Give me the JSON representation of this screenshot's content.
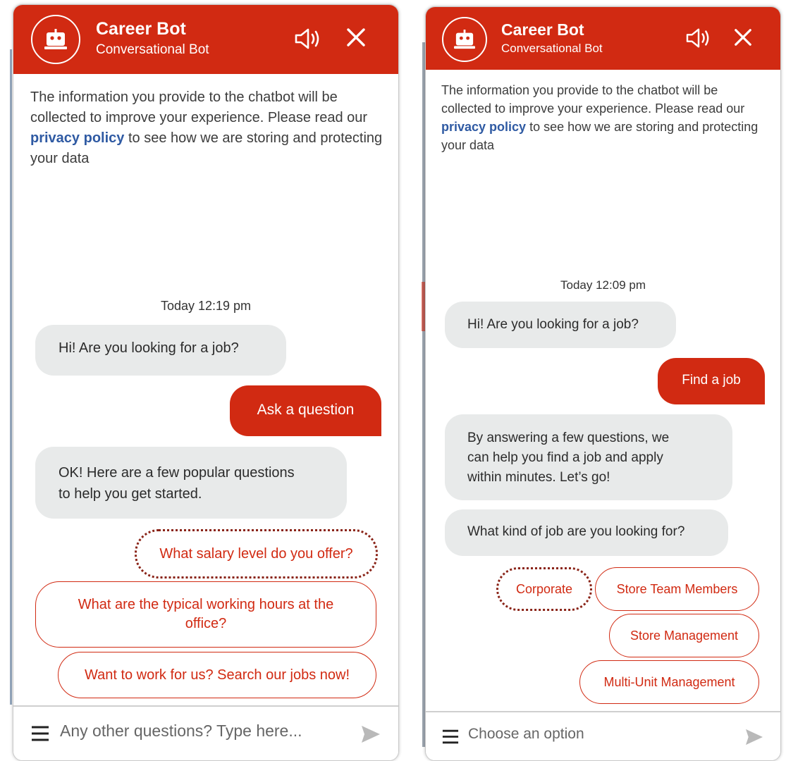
{
  "colors": {
    "brand": "#d12a12",
    "bot_bubble": "#e8eaea",
    "link": "#2f5aa3"
  },
  "left": {
    "header": {
      "title": "Career Bot",
      "subtitle": "Conversational Bot",
      "icons": [
        "robot-icon",
        "speaker-icon",
        "close-icon"
      ]
    },
    "disclaimer": {
      "before": "The information you provide to the chatbot will be collected to improve your experience. Please read our ",
      "link": "privacy policy",
      "after": " to see how we are storing and protecting your data"
    },
    "timestamp": "Today 12:19 pm",
    "messages": {
      "bot1": "Hi! Are you looking for a job?",
      "user1": "Ask a question",
      "bot2_line1": "OK! Here are a few popular questions",
      "bot2_line2": "to help you get started."
    },
    "options": {
      "opt1": "What salary level do you offer?",
      "opt2_line1": "What are the typical working hours at the",
      "opt2_line2": "office?",
      "opt3": "Want to work for us? Search our jobs now!"
    },
    "footer": {
      "placeholder": "Any other questions? Type here...",
      "icons": [
        "menu-icon",
        "send-icon"
      ]
    }
  },
  "right": {
    "header": {
      "title": "Career Bot",
      "subtitle": "Conversational Bot",
      "icons": [
        "robot-icon",
        "speaker-icon",
        "close-icon"
      ]
    },
    "disclaimer": {
      "before": "The information you provide to the chatbot will be collected to improve your experience. Please read our ",
      "link": "privacy policy",
      "after": " to see how we are storing and protecting your data"
    },
    "timestamp": "Today 12:09 pm",
    "messages": {
      "bot1": "Hi! Are you looking for a job?",
      "user1": "Find a job",
      "bot2_line1": "By answering a few questions, we",
      "bot2_line2": "can help you find a job and apply",
      "bot2_line3": "within minutes. Let’s go!",
      "bot3": "What kind of job are you looking for?"
    },
    "options": {
      "corporate": "Corporate",
      "store_team": "Store Team Members",
      "store_mgmt": "Store Management",
      "multi_unit": "Multi-Unit Management"
    },
    "footer": {
      "placeholder": "Choose an option",
      "icons": [
        "menu-icon",
        "send-icon"
      ]
    }
  }
}
